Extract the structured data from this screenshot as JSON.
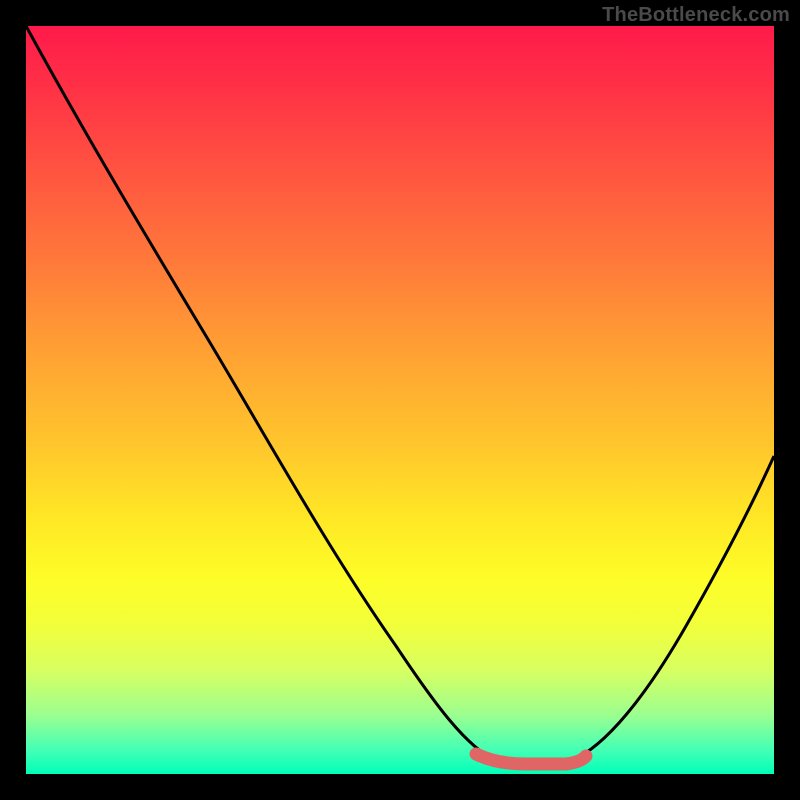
{
  "watermark": "TheBottleneck.com",
  "colors": {
    "background": "#000000",
    "gradient_top": "#ff1a4b",
    "gradient_bottom": "#00ffb8",
    "curve": "#000000",
    "highlight": "#e06666"
  },
  "chart_data": {
    "type": "line",
    "title": "",
    "xlabel": "",
    "ylabel": "",
    "xlim": [
      0,
      100
    ],
    "ylim": [
      0,
      100
    ],
    "series": [
      {
        "name": "bottleneck-curve",
        "x": [
          0,
          10,
          20,
          30,
          40,
          50,
          58,
          63,
          68,
          73,
          80,
          88,
          95,
          100
        ],
        "values": [
          100,
          86,
          72,
          58,
          44,
          29,
          15,
          6,
          2,
          2,
          6,
          18,
          32,
          43
        ]
      }
    ],
    "highlight_range": {
      "x_start": 60,
      "x_end": 74,
      "y": 2
    }
  }
}
